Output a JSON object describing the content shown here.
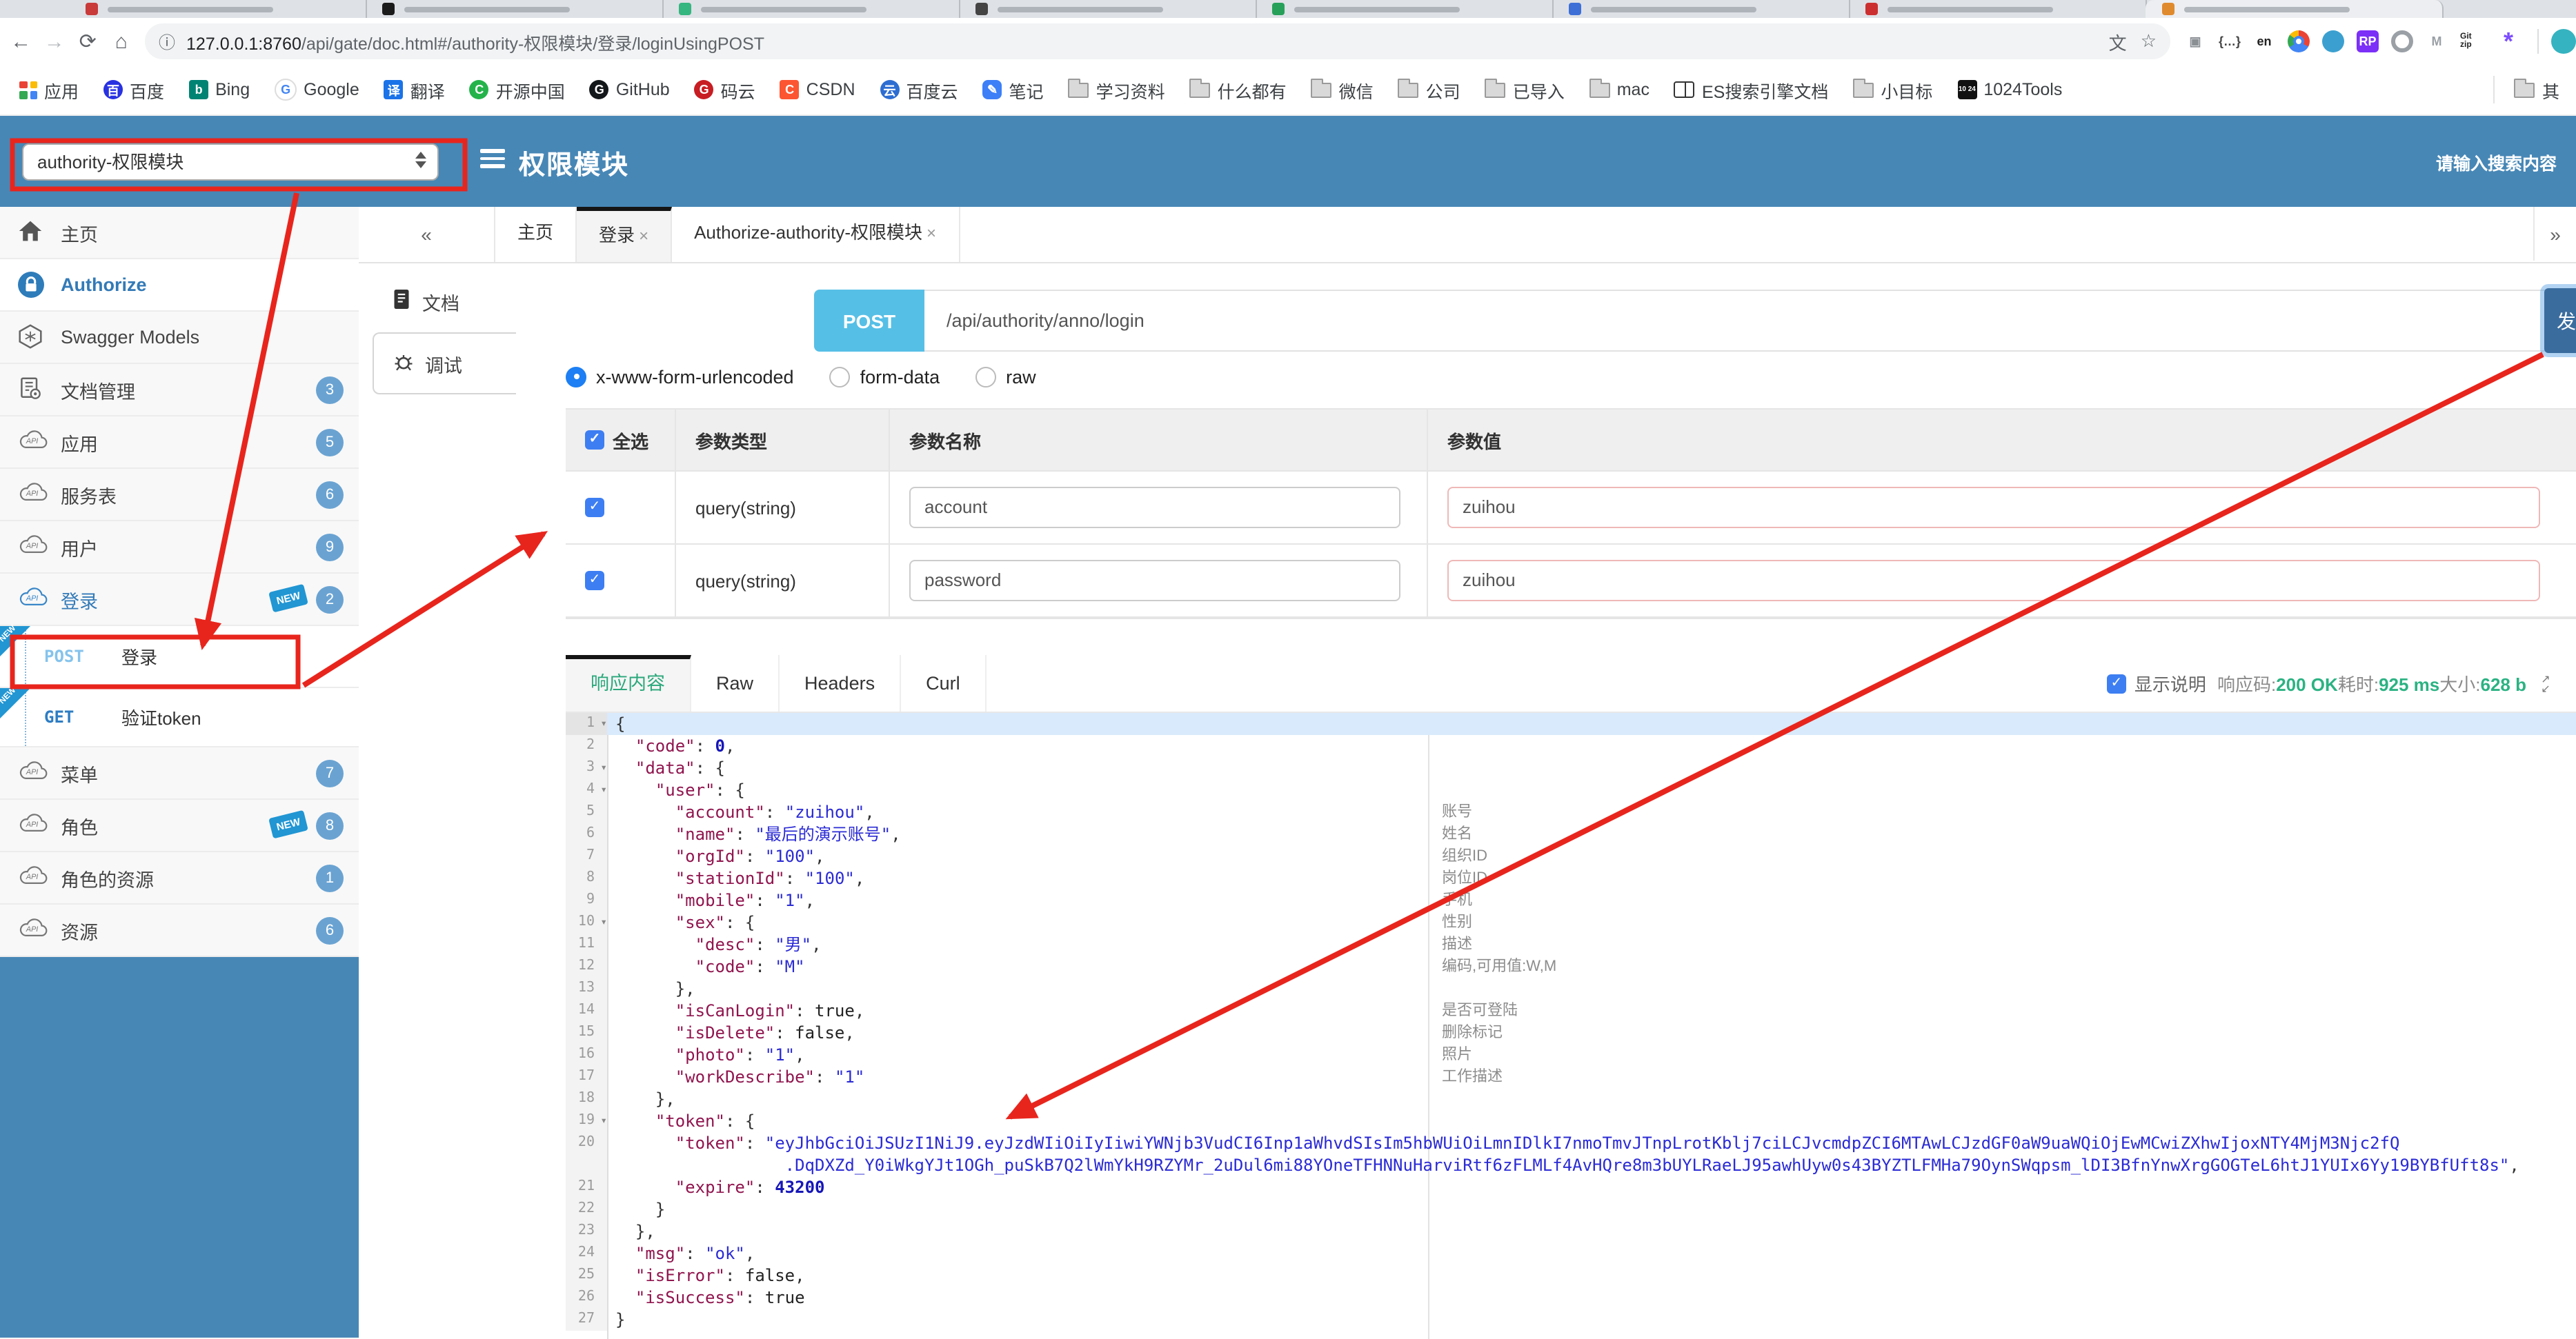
{
  "browser": {
    "tab_icon_colors": [
      "#c93a3a",
      "#1b1b1b",
      "#35b57f",
      "#444444",
      "#27a05a",
      "#3d6fd6",
      "#cc2f2f",
      "#e08a2e"
    ],
    "nav": {
      "back": "←",
      "forward": "→",
      "reload": "⟳",
      "home": "⌂"
    },
    "url": {
      "info": "ⓘ",
      "host": "127.0.0.1:8760",
      "path": "/api/gate/doc.html#/authority-权限模块/登录/loginUsingPOST"
    },
    "actions": {
      "translate": "文",
      "star": "☆"
    },
    "extensions": [
      {
        "name": "qr-extension",
        "glyph": "▣",
        "fg": "#8a8f94",
        "bg": ""
      },
      {
        "name": "json-braces-extension",
        "glyph": "{…}",
        "fg": "#444",
        "bg": ""
      },
      {
        "name": "en-translate-extension",
        "glyph": "en",
        "fg": "#222",
        "bg": ""
      },
      {
        "name": "chrome-extension",
        "glyph": "",
        "fg": "",
        "bg": "chrome"
      },
      {
        "name": "globe-extension",
        "glyph": "",
        "fg": "",
        "bg": "globe"
      },
      {
        "name": "rp-extension",
        "glyph": "RP",
        "fg": "#fff",
        "bg": "#7b2ff7"
      },
      {
        "name": "ring-extension",
        "glyph": "",
        "fg": "",
        "bg": "ring"
      },
      {
        "name": "m-extension",
        "glyph": "M",
        "fg": "#9aa0a6",
        "bg": ""
      },
      {
        "name": "gitzip-extension",
        "glyph": "Git zip",
        "fg": "#222",
        "bg": ""
      },
      {
        "name": "asterisk-extension",
        "glyph": "*",
        "fg": "#7c4dff",
        "bg": ""
      },
      {
        "name": "avatar",
        "glyph": "",
        "fg": "",
        "bg": "#35b3c0"
      }
    ],
    "bookmarks": [
      {
        "label": "应用",
        "icon": "apps"
      },
      {
        "label": "百度",
        "icon": "letter",
        "glyph": "百",
        "bg": "#2932e1",
        "fg": "#fff",
        "shape": "ci"
      },
      {
        "label": "Bing",
        "icon": "letter",
        "glyph": "b",
        "bg": "#008373",
        "fg": "#fff",
        "shape": "sq"
      },
      {
        "label": "Google",
        "icon": "letter",
        "glyph": "G",
        "bg": "#ffffff",
        "fg": "#4285f4",
        "shape": "ci"
      },
      {
        "label": "翻译",
        "icon": "letter",
        "glyph": "译",
        "bg": "#1a73e8",
        "fg": "#fff",
        "shape": "sq"
      },
      {
        "label": "开源中国",
        "icon": "letter",
        "glyph": "C",
        "bg": "#24b34b",
        "fg": "#fff",
        "shape": "ci"
      },
      {
        "label": "GitHub",
        "icon": "letter",
        "glyph": "G",
        "bg": "#14171a",
        "fg": "#fff",
        "shape": "ci"
      },
      {
        "label": "码云",
        "icon": "letter",
        "glyph": "G",
        "bg": "#c71d23",
        "fg": "#fff",
        "shape": "ci"
      },
      {
        "label": "CSDN",
        "icon": "letter",
        "glyph": "C",
        "bg": "#fc5531",
        "fg": "#fff",
        "shape": "sq"
      },
      {
        "label": "百度云",
        "icon": "letter",
        "glyph": "云",
        "bg": "#2c6dd2",
        "fg": "#fff",
        "shape": "ci"
      },
      {
        "label": "笔记",
        "icon": "letter",
        "glyph": "✎",
        "bg": "#3d7ff7",
        "fg": "#fff",
        "shape": "rd"
      },
      {
        "label": "学习资料",
        "icon": "folder"
      },
      {
        "label": "什么都有",
        "icon": "folder"
      },
      {
        "label": "微信",
        "icon": "folder"
      },
      {
        "label": "公司",
        "icon": "folder"
      },
      {
        "label": "已导入",
        "icon": "folder"
      },
      {
        "label": "mac",
        "icon": "folder"
      },
      {
        "label": "ES搜索引擎文档",
        "icon": "book"
      },
      {
        "label": "小目标",
        "icon": "folder"
      },
      {
        "label": "1024Tools",
        "icon": "letter",
        "glyph": "10 24",
        "bg": "#111",
        "fg": "#fff",
        "shape": "sq",
        "tiny": true
      }
    ],
    "bookmarks_overflow": "其"
  },
  "header": {
    "module_select": "authority-权限模块",
    "title": "权限模块",
    "search_placeholder": "请输入搜索内容"
  },
  "sidebar": {
    "items": [
      {
        "type": "nav",
        "label": "主页",
        "icon": "home"
      },
      {
        "type": "nav",
        "label": "Authorize",
        "icon": "lock",
        "active": true
      },
      {
        "type": "nav",
        "label": "Swagger Models",
        "icon": "models"
      },
      {
        "type": "nav",
        "label": "文档管理",
        "icon": "docs",
        "badge": "3"
      },
      {
        "type": "nav",
        "label": "应用",
        "icon": "api",
        "badge": "5"
      },
      {
        "type": "nav",
        "label": "服务表",
        "icon": "api",
        "badge": "6"
      },
      {
        "type": "nav",
        "label": "用户",
        "icon": "api",
        "badge": "9"
      },
      {
        "type": "nav",
        "label": "登录",
        "icon": "api",
        "badge": "2",
        "new_tag": true,
        "linkblue": true
      },
      {
        "type": "endpoint",
        "method": "POST",
        "label": "登录",
        "new_corner": true
      },
      {
        "type": "endpoint",
        "method": "GET",
        "label": "验证token",
        "new_corner": true
      },
      {
        "type": "nav",
        "label": "菜单",
        "icon": "api",
        "badge": "7"
      },
      {
        "type": "nav",
        "label": "角色",
        "icon": "api",
        "badge": "8",
        "new_tag": true
      },
      {
        "type": "nav",
        "label": "角色的资源",
        "icon": "api",
        "badge": "1"
      },
      {
        "type": "nav",
        "label": "资源",
        "icon": "api",
        "badge": "6"
      }
    ],
    "new_tag_text": "NEW"
  },
  "main_tabs": {
    "collapse": "«",
    "expand": "»",
    "close_glyph": "×",
    "items": [
      {
        "label": "主页",
        "closable": false,
        "active": false
      },
      {
        "label": "登录",
        "closable": true,
        "active": true
      },
      {
        "label": "Authorize-authority-权限模块",
        "closable": true,
        "active": false
      }
    ]
  },
  "doc_tabs": [
    {
      "label": "文档",
      "icon": "doc",
      "active": false
    },
    {
      "label": "调试",
      "icon": "debug",
      "active": true
    }
  ],
  "request": {
    "method": "POST",
    "path": "/api/authority/anno/login",
    "send_label": "发",
    "body_types": [
      {
        "label": "x-www-form-urlencoded",
        "selected": true
      },
      {
        "label": "form-data",
        "selected": false
      },
      {
        "label": "raw",
        "selected": false
      }
    ]
  },
  "params_table": {
    "headers": [
      "全选",
      "参数类型",
      "参数名称",
      "参数值"
    ],
    "rows": [
      {
        "checked": true,
        "type": "query(string)",
        "name": "account",
        "value": "zuihou"
      },
      {
        "checked": true,
        "type": "query(string)",
        "name": "password",
        "value": "zuihou"
      }
    ]
  },
  "response": {
    "tabs": [
      {
        "label": "响应内容",
        "active": true
      },
      {
        "label": "Raw",
        "active": false
      },
      {
        "label": "Headers",
        "active": false
      },
      {
        "label": "Curl",
        "active": false
      }
    ],
    "show_desc": "显示说明",
    "meta": [
      {
        "label": "响应码:",
        "value": "200 OK"
      },
      {
        "label": "耗时:",
        "value": "925 ms"
      },
      {
        "label": "大小:",
        "value": "628 b"
      }
    ]
  },
  "code": {
    "lines": [
      {
        "n": "1",
        "fold": true,
        "active": true,
        "c": null,
        "t": [
          [
            "p",
            "{"
          ]
        ]
      },
      {
        "n": "2",
        "fold": false,
        "c": null,
        "t": [
          [
            "w",
            "  "
          ],
          [
            "k",
            "\"code\""
          ],
          [
            "p",
            ": "
          ],
          [
            "n",
            "0"
          ],
          [
            "p",
            ","
          ]
        ]
      },
      {
        "n": "3",
        "fold": true,
        "c": null,
        "t": [
          [
            "w",
            "  "
          ],
          [
            "k",
            "\"data\""
          ],
          [
            "p",
            ": {"
          ]
        ]
      },
      {
        "n": "4",
        "fold": true,
        "c": null,
        "t": [
          [
            "w",
            "    "
          ],
          [
            "k",
            "\"user\""
          ],
          [
            "p",
            ": {"
          ]
        ]
      },
      {
        "n": "5",
        "fold": false,
        "c": "账号",
        "t": [
          [
            "w",
            "      "
          ],
          [
            "k",
            "\"account\""
          ],
          [
            "p",
            ": "
          ],
          [
            "s",
            "\"zuihou\""
          ],
          [
            "p",
            ","
          ]
        ]
      },
      {
        "n": "6",
        "fold": false,
        "c": "姓名",
        "t": [
          [
            "w",
            "      "
          ],
          [
            "k",
            "\"name\""
          ],
          [
            "p",
            ": "
          ],
          [
            "s",
            "\"最后的演示账号\""
          ],
          [
            "p",
            ","
          ]
        ]
      },
      {
        "n": "7",
        "fold": false,
        "c": "组织ID",
        "t": [
          [
            "w",
            "      "
          ],
          [
            "k",
            "\"orgId\""
          ],
          [
            "p",
            ": "
          ],
          [
            "s",
            "\"100\""
          ],
          [
            "p",
            ","
          ]
        ]
      },
      {
        "n": "8",
        "fold": false,
        "c": "岗位ID",
        "t": [
          [
            "w",
            "      "
          ],
          [
            "k",
            "\"stationId\""
          ],
          [
            "p",
            ": "
          ],
          [
            "s",
            "\"100\""
          ],
          [
            "p",
            ","
          ]
        ]
      },
      {
        "n": "9",
        "fold": false,
        "c": "手机",
        "t": [
          [
            "w",
            "      "
          ],
          [
            "k",
            "\"mobile\""
          ],
          [
            "p",
            ": "
          ],
          [
            "s",
            "\"1\""
          ],
          [
            "p",
            ","
          ]
        ]
      },
      {
        "n": "10",
        "fold": true,
        "c": "性别",
        "t": [
          [
            "w",
            "      "
          ],
          [
            "k",
            "\"sex\""
          ],
          [
            "p",
            ": {"
          ]
        ]
      },
      {
        "n": "11",
        "fold": false,
        "c": "描述",
        "t": [
          [
            "w",
            "        "
          ],
          [
            "k",
            "\"desc\""
          ],
          [
            "p",
            ": "
          ],
          [
            "s",
            "\"男\""
          ],
          [
            "p",
            ","
          ]
        ]
      },
      {
        "n": "12",
        "fold": false,
        "c": "编码,可用值:W,M",
        "t": [
          [
            "w",
            "        "
          ],
          [
            "k",
            "\"code\""
          ],
          [
            "p",
            ": "
          ],
          [
            "s",
            "\"M\""
          ]
        ]
      },
      {
        "n": "13",
        "fold": false,
        "c": null,
        "t": [
          [
            "w",
            "      "
          ],
          [
            "p",
            "},"
          ]
        ]
      },
      {
        "n": "14",
        "fold": false,
        "c": "是否可登陆",
        "t": [
          [
            "w",
            "      "
          ],
          [
            "k",
            "\"isCanLogin\""
          ],
          [
            "p",
            ": "
          ],
          [
            "b",
            "true"
          ],
          [
            "p",
            ","
          ]
        ]
      },
      {
        "n": "15",
        "fold": false,
        "c": "删除标记",
        "t": [
          [
            "w",
            "      "
          ],
          [
            "k",
            "\"isDelete\""
          ],
          [
            "p",
            ": "
          ],
          [
            "b",
            "false"
          ],
          [
            "p",
            ","
          ]
        ]
      },
      {
        "n": "16",
        "fold": false,
        "c": "照片",
        "t": [
          [
            "w",
            "      "
          ],
          [
            "k",
            "\"photo\""
          ],
          [
            "p",
            ": "
          ],
          [
            "s",
            "\"1\""
          ],
          [
            "p",
            ","
          ]
        ]
      },
      {
        "n": "17",
        "fold": false,
        "c": "工作描述",
        "t": [
          [
            "w",
            "      "
          ],
          [
            "k",
            "\"workDescribe\""
          ],
          [
            "p",
            ": "
          ],
          [
            "s",
            "\"1\""
          ]
        ]
      },
      {
        "n": "18",
        "fold": false,
        "c": null,
        "t": [
          [
            "w",
            "    "
          ],
          [
            "p",
            "},"
          ]
        ]
      },
      {
        "n": "19",
        "fold": true,
        "c": null,
        "t": [
          [
            "w",
            "    "
          ],
          [
            "k",
            "\"token\""
          ],
          [
            "p",
            ": {"
          ]
        ]
      },
      {
        "n": "20",
        "fold": false,
        "c": null,
        "t": [
          [
            "w",
            "      "
          ],
          [
            "k",
            "\"token\""
          ],
          [
            "p",
            ": "
          ],
          [
            "s",
            "\"eyJhbGciOiJSUzI1NiJ9.eyJzdWIiOiIyIiwiYWNjb3VudCI6Inp1aWhvdSIsIm5hbWUiOiLmnIDlkI7nmoTmvJTnpLrotKblj7ciLCJvcmdpZCI6MTAwLCJzdGF0aW9uaWQiOjEwMCwiZXhwIjoxNTY4MjM3Njc2fQ"
          ]
        ]
      },
      {
        "n": null,
        "fold": false,
        "c": null,
        "t": [
          [
            "w",
            "                 "
          ],
          [
            "s",
            ".DqDXZd_Y0iWkgYJt1OGh_puSkB7Q2lWmYkH9RZYMr_2uDul6mi88YOneTFHNNuHarviRtf6zFLMLf4AvHQre8m3bUYLRaeLJ95awhUyw0s43BYZTLFMHa79OynSWqpsm_lDI3BfnYnwXrgGOGTeL6htJ1YUIx6Yy19BYBfUft8s\""
          ],
          [
            "p",
            ","
          ]
        ]
      },
      {
        "n": "21",
        "fold": false,
        "c": null,
        "t": [
          [
            "w",
            "      "
          ],
          [
            "k",
            "\"expire\""
          ],
          [
            "p",
            ": "
          ],
          [
            "n",
            "43200"
          ]
        ]
      },
      {
        "n": "22",
        "fold": false,
        "c": null,
        "t": [
          [
            "w",
            "    "
          ],
          [
            "p",
            "}"
          ]
        ]
      },
      {
        "n": "23",
        "fold": false,
        "c": null,
        "t": [
          [
            "w",
            "  "
          ],
          [
            "p",
            "},"
          ]
        ]
      },
      {
        "n": "24",
        "fold": false,
        "c": null,
        "t": [
          [
            "w",
            "  "
          ],
          [
            "k",
            "\"msg\""
          ],
          [
            "p",
            ": "
          ],
          [
            "s",
            "\"ok\""
          ],
          [
            "p",
            ","
          ]
        ]
      },
      {
        "n": "25",
        "fold": false,
        "c": null,
        "t": [
          [
            "w",
            "  "
          ],
          [
            "k",
            "\"isError\""
          ],
          [
            "p",
            ": "
          ],
          [
            "b",
            "false"
          ],
          [
            "p",
            ","
          ]
        ]
      },
      {
        "n": "26",
        "fold": false,
        "c": null,
        "t": [
          [
            "w",
            "  "
          ],
          [
            "k",
            "\"isSuccess\""
          ],
          [
            "p",
            ": "
          ],
          [
            "b",
            "true"
          ]
        ]
      },
      {
        "n": "27",
        "fold": false,
        "c": null,
        "t": [
          [
            "p",
            "}"
          ]
        ]
      }
    ]
  },
  "colors": {
    "header_blue": "#4787b6",
    "annotation_red": "#e8251d",
    "success_green": "#2bb283",
    "post_badge": "#56bfe6",
    "badge_blue": "#6aa3d2",
    "new_blue": "#2196d3"
  }
}
